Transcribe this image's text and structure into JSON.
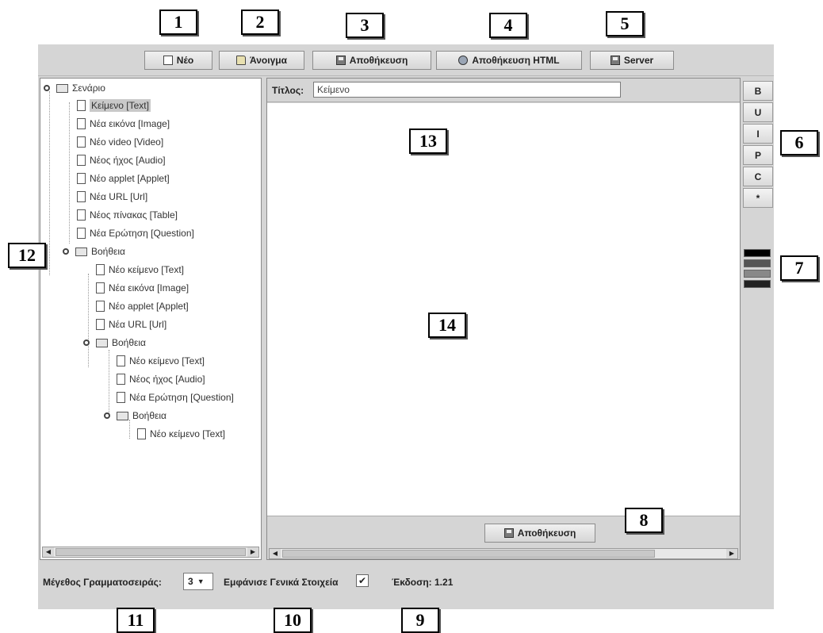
{
  "toolbar": {
    "new_label": "Νέο",
    "open_label": "Άνοιγμα",
    "save_label": "Αποθήκευση",
    "save_html_label": "Αποθήκευση HTML",
    "server_label": "Server",
    "icons": {
      "new": "new-document-icon",
      "open": "open-folder-icon",
      "save": "floppy-disk-icon",
      "save_html": "html-globe-icon",
      "server": "floppy-disk-icon"
    }
  },
  "tree": {
    "root": "Σενάριο",
    "items": [
      {
        "label": "Κείμενο [Text]",
        "selected": true
      },
      {
        "label": "Νέα εικόνα [Image]"
      },
      {
        "label": "Νέο video [Video]"
      },
      {
        "label": "Νέος ήχος [Audio]"
      },
      {
        "label": "Νέο applet [Applet]"
      },
      {
        "label": "Νέα URL [Url]"
      },
      {
        "label": "Νέος πίνακας [Table]"
      },
      {
        "label": "Νέα Ερώτηση [Question]"
      }
    ],
    "help1": {
      "label": "Βοήθεια",
      "items": [
        "Νέο κείμενο [Text]",
        "Νέα εικόνα [Image]",
        "Νέο applet [Applet]",
        "Νέα URL [Url]"
      ]
    },
    "help2": {
      "label": "Βοήθεια",
      "items": [
        "Νέο κείμενο [Text]",
        "Νέος ήχος [Audio]",
        "Νέα Ερώτηση [Question]"
      ]
    },
    "help3": {
      "label": "Βοήθεια",
      "items": [
        "Νέο κείμενο [Text]"
      ]
    }
  },
  "editor": {
    "title_label": "Τίτλος:",
    "title_value": "Κείμενο",
    "save_label": "Αποθήκευση"
  },
  "format_buttons": [
    "B",
    "U",
    "I",
    "P",
    "C",
    "*"
  ],
  "colors": [
    "#000000",
    "#555555",
    "#888888",
    "#222222"
  ],
  "status": {
    "font_size_label": "Μέγεθος Γραμματοσειράς:",
    "font_size_value": "3",
    "show_general_label": "Εμφάνισε Γενικά Στοιχεία",
    "show_general_checked": "✔",
    "version_label": "Έκδοση: 1.21"
  },
  "callouts": {
    "c1": "1",
    "c2": "2",
    "c3": "3",
    "c4": "4",
    "c5": "5",
    "c6": "6",
    "c7": "7",
    "c8": "8",
    "c9": "9",
    "c10": "10",
    "c11": "11",
    "c12": "12",
    "c13": "13",
    "c14": "14"
  }
}
